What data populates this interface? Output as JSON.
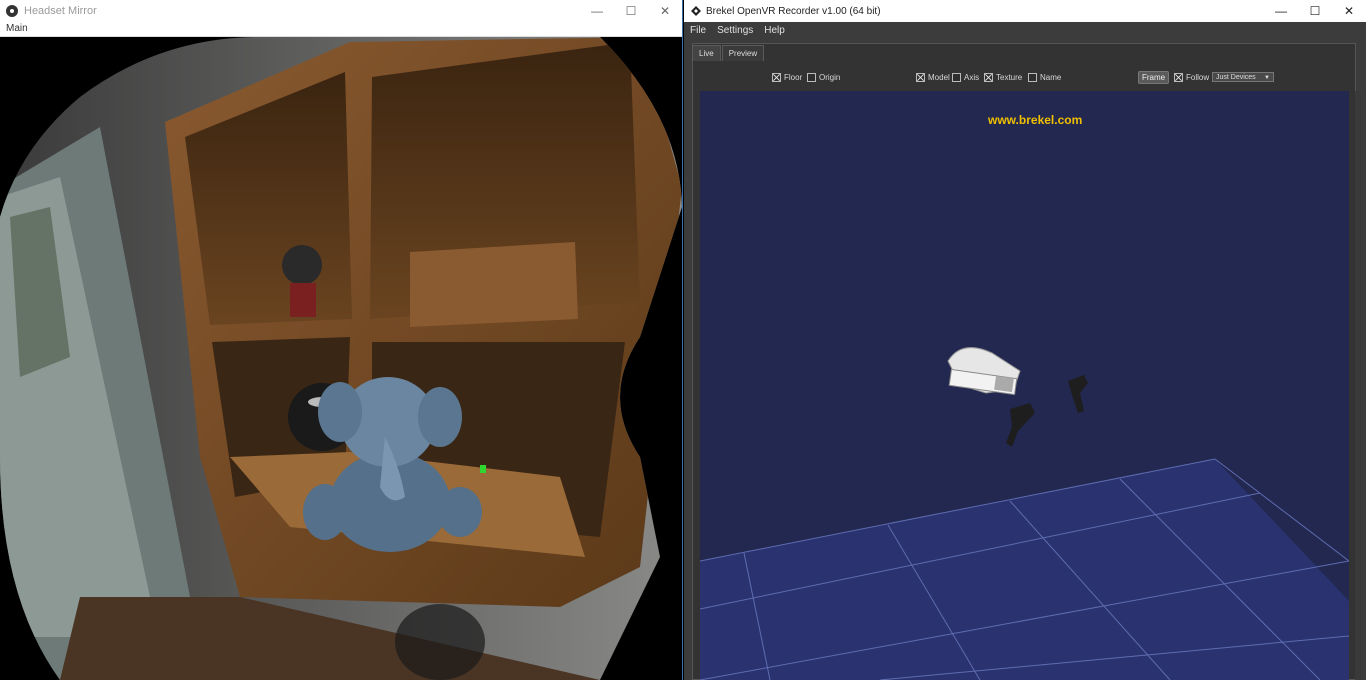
{
  "left_window": {
    "title": "Headset Mirror",
    "menu": [
      "Main"
    ],
    "controls": {
      "minimize": "—",
      "maximize": "☐",
      "close": "✕"
    }
  },
  "right_window": {
    "title": "Brekel OpenVR Recorder v1.00 (64 bit)",
    "menu": [
      "File",
      "Settings",
      "Help"
    ],
    "controls": {
      "minimize": "—",
      "maximize": "☐",
      "close": "✕"
    },
    "tabs": [
      {
        "label": "Live",
        "active": true
      },
      {
        "label": "Preview",
        "active": false
      }
    ],
    "toolbar": {
      "floor": {
        "label": "Floor",
        "checked": true
      },
      "origin": {
        "label": "Origin",
        "checked": false
      },
      "model": {
        "label": "Model",
        "checked": true
      },
      "axis": {
        "label": "Axis",
        "checked": false
      },
      "texture": {
        "label": "Texture",
        "checked": true
      },
      "name": {
        "label": "Name",
        "checked": false
      },
      "frame_button": "Frame",
      "follow": {
        "label": "Follow",
        "checked": true
      },
      "follow_target": "Just Devices"
    },
    "viewport": {
      "watermark": "www.brekel.com",
      "background_color": "#232850",
      "grid_color": "#3a4a8c"
    }
  }
}
